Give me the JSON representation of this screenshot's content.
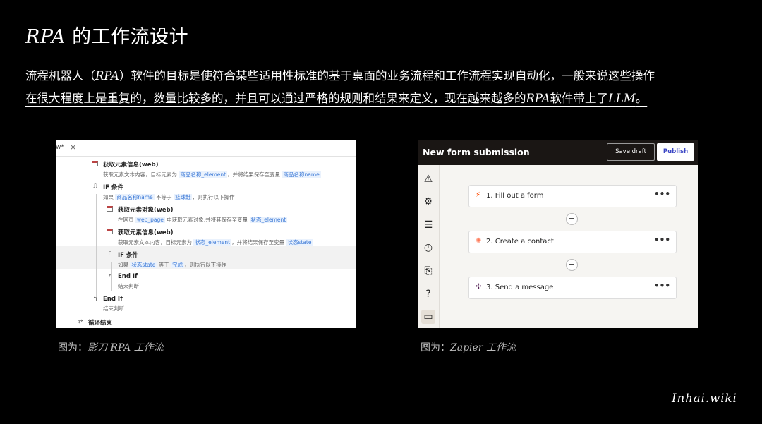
{
  "title": {
    "prefix": "RPA",
    "rest": " 的工作流设计"
  },
  "paragraph": {
    "line1_a": "流程机器人（",
    "line1_rpa": "RPA",
    "line1_b": "）软件的目标是使符合某些适用性标准的基于桌面的业务流程和工作流程实现自动化，一般来说这些操作",
    "line2_a": "在很大程度上是重复的，数量比较多的，并且可以通过严格的规则和结果来定义，现在越来越多的",
    "line2_rpa": "RPA",
    "line2_b": "软件带上了",
    "line2_llm": "LLM",
    "line2_end": "。"
  },
  "left_shot": {
    "tab_name": "w*",
    "tab_close": "×",
    "steps": [
      {
        "title": "获取元素信息(web)",
        "desc_a": "获取元素文本内容，目标元素为 ",
        "var1": "商品名称_element",
        "desc_b": "，并将结果保存至变量 ",
        "var2": "商品名称name"
      },
      {
        "title": "IF 条件",
        "desc_a": "如果 ",
        "var1": "商品名称name",
        "desc_b": " 不等于 ",
        "var2": "篮球鞋",
        "desc_c": "，则执行以下操作"
      },
      {
        "title": "获取元素对象(web)",
        "desc_a": "在网页 ",
        "var1": "web_page",
        "desc_b": " 中获取元素对象,并将其保存至变量 ",
        "var2": "状态_element"
      },
      {
        "title": "获取元素信息(web)",
        "desc_a": "获取元素文本内容，目标元素为 ",
        "var1": "状态_element",
        "desc_b": "，并将结果保存至变量 ",
        "var2": "状态state"
      },
      {
        "title": "IF 条件",
        "desc_a": "如果 ",
        "var1": "状态state",
        "desc_b": " 等于 ",
        "var2": "完成",
        "desc_c": "，则执行以下操作"
      },
      {
        "title": "End If",
        "desc_a": "结束判断"
      },
      {
        "title": "End If",
        "desc_a": "结束判断"
      },
      {
        "title": "循环结束"
      }
    ]
  },
  "right_shot": {
    "header_title": "New form submission",
    "save_draft": "Save draft",
    "publish": "Publish",
    "steps": [
      {
        "label": "1. Fill out a form",
        "icon": "form-icon",
        "color": "#ff4a00"
      },
      {
        "label": "2. Create a contact",
        "icon": "hubspot-icon",
        "color": "#ff7a59"
      },
      {
        "label": "3. Send a message",
        "icon": "slack-icon",
        "color": "#4a154b"
      }
    ],
    "more": "•••",
    "plus": "+"
  },
  "captions": {
    "left_prefix": "图为：",
    "left_italic": "影刀 RPA 工作流",
    "right_prefix": "图为：",
    "right_italic": "Zapier 工作流"
  },
  "brand": "Inhai.wiki"
}
